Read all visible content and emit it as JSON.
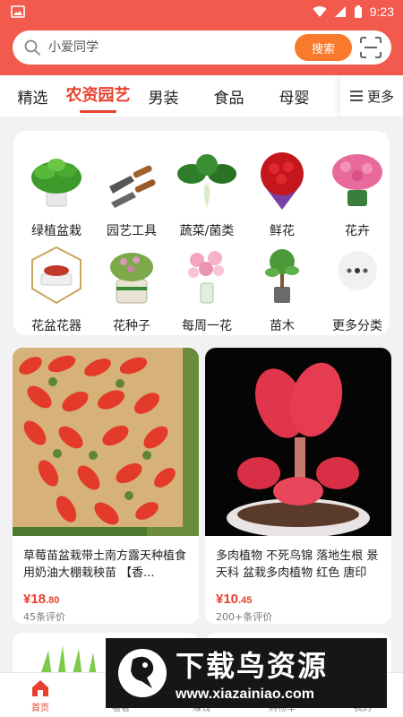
{
  "status_bar": {
    "time": "9:23"
  },
  "search": {
    "placeholder": "小爱同学",
    "button_label": "搜索"
  },
  "tabs": {
    "items": [
      "精选",
      "农资园艺",
      "男装",
      "食品",
      "母婴"
    ],
    "active_index": 1,
    "more_label": "更多"
  },
  "categories": [
    {
      "label": "绿植盆栽",
      "icon": "potted-plant"
    },
    {
      "label": "园艺工具",
      "icon": "garden-trowels"
    },
    {
      "label": "蔬菜/菌类",
      "icon": "vegetable"
    },
    {
      "label": "鲜花",
      "icon": "red-roses"
    },
    {
      "label": "花卉",
      "icon": "pink-flowers"
    },
    {
      "label": "花盆花器",
      "icon": "flower-pot"
    },
    {
      "label": "花种子",
      "icon": "seedling-pot"
    },
    {
      "label": "每周一花",
      "icon": "flower-vase"
    },
    {
      "label": "苗木",
      "icon": "sapling"
    },
    {
      "label": "更多分类",
      "icon": "more-dots"
    }
  ],
  "products": [
    {
      "title": "草莓苗盆栽带土南方露天种植食用奶油大棚栽秧苗 【香...",
      "price_main": "¥18",
      "price_decimal": ".80",
      "reviews": "45条评价"
    },
    {
      "title": "多肉植物 不死鸟锦 落地生根 景天科 盆栽多肉植物 红色 唐印3...",
      "price_main": "¥10",
      "price_decimal": ".45",
      "reviews": "200+条评价"
    }
  ],
  "bottom_nav": {
    "items": [
      "首页",
      "看看",
      "赚钱",
      "购物车",
      "我的"
    ],
    "active_index": 0
  },
  "watermark": {
    "title": "下载鸟资源",
    "url": "www.xiazainiao.com"
  },
  "colors": {
    "brand": "#f25a4e",
    "search_button": "#f97a2d",
    "accent": "#e8412f"
  }
}
